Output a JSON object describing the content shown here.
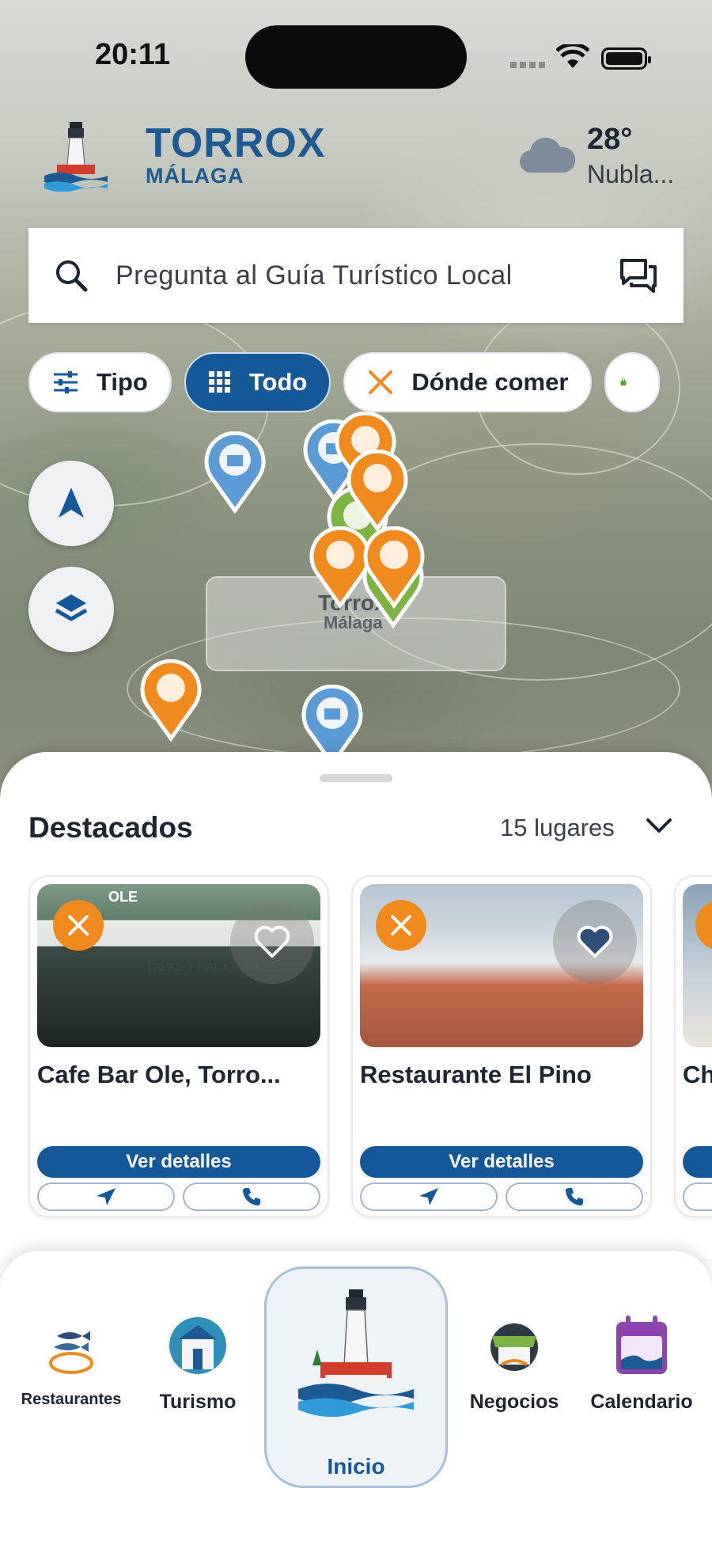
{
  "status_bar": {
    "time": "20:11"
  },
  "brand": {
    "title": "TORROX",
    "subtitle": "MÁLAGA",
    "logo_icon": "lighthouse-logo"
  },
  "weather": {
    "temperature": "28°",
    "description": "Nubla...",
    "icon": "cloud-icon"
  },
  "search": {
    "placeholder": "Pregunta al Guía Turístico Local",
    "search_icon": "search-icon",
    "chat_icon": "chat-icon"
  },
  "filters": {
    "chips": [
      {
        "label": "Tipo",
        "icon": "sliders-icon",
        "active": false
      },
      {
        "label": "Todo",
        "icon": "grid-icon",
        "active": true
      },
      {
        "label": "Dónde comer",
        "icon": "utensils-icon",
        "active": false
      }
    ]
  },
  "map": {
    "label_title": "Torrox",
    "label_subtitle": "Málaga"
  },
  "featured": {
    "title": "Destacados",
    "count": "15 lugares",
    "cards": [
      {
        "name": "Cafe Bar Ole, Torro...",
        "button": "Ver detalles",
        "category_icon": "utensils-icon"
      },
      {
        "name": "Restaurante El Pino",
        "button": "Ver detalles",
        "category_icon": "utensils-icon"
      },
      {
        "name": "Ch",
        "button": "Ver detalles",
        "category_icon": "utensils-icon"
      }
    ],
    "img_sign_1": "TAPAS Y RACIONES",
    "img_sign_2": "OLE"
  },
  "colors": {
    "primary": "#15589a",
    "accent_orange": "#f08a1c",
    "green_pin": "#7cb342",
    "blue_pin": "#5b9bd5"
  },
  "nav": {
    "items": [
      {
        "label": "Restaurantes"
      },
      {
        "label": "Turismo"
      },
      {
        "label": "Inicio"
      },
      {
        "label": "Negocios"
      },
      {
        "label": "Calendario"
      }
    ]
  }
}
